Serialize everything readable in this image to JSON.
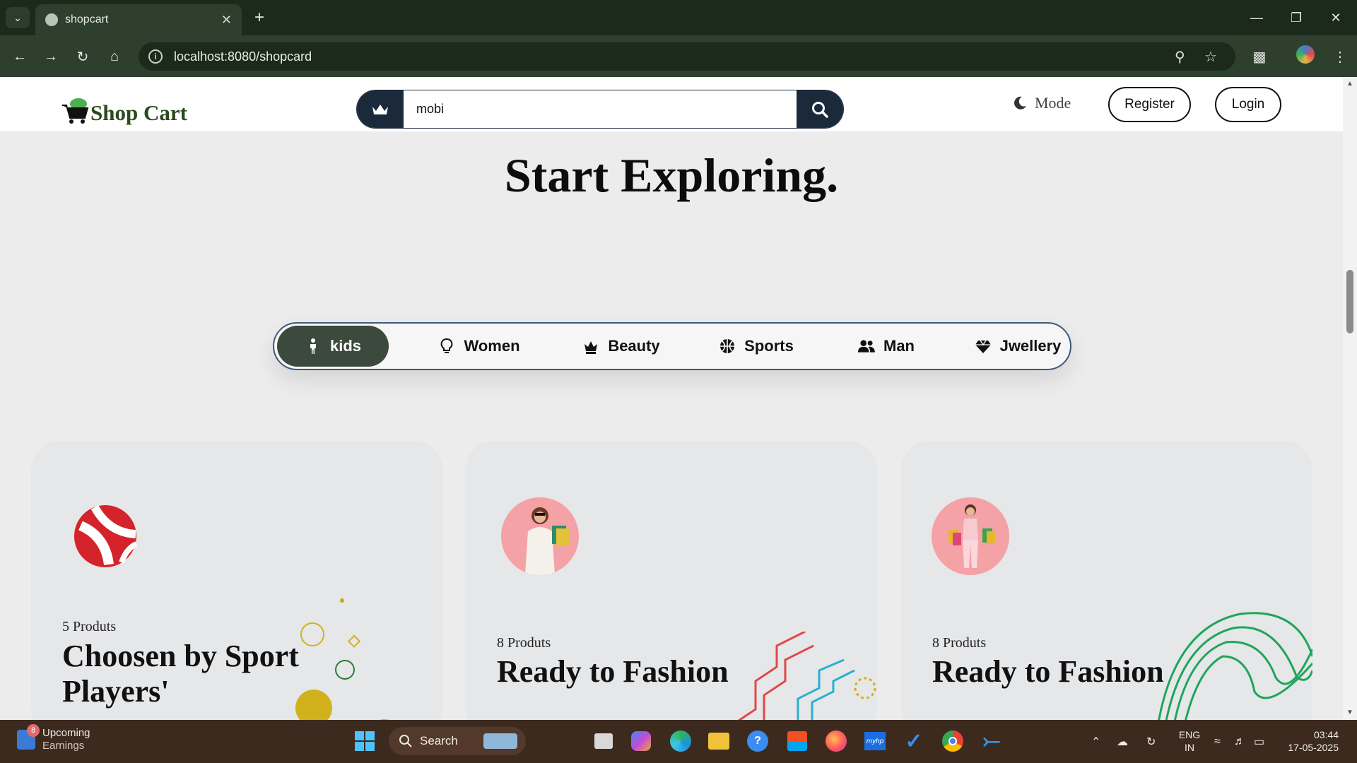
{
  "browser": {
    "tab_title": "shopcart",
    "url": "localhost:8080/shopcard"
  },
  "site": {
    "brand": "Shop Cart",
    "search_value": "mobi",
    "mode_label": "Mode",
    "register_label": "Register",
    "login_label": "Login"
  },
  "hero": {
    "title": "Start Exploring."
  },
  "categories": [
    {
      "label": "kids",
      "icon": "child-icon",
      "active": true
    },
    {
      "label": "Women",
      "icon": "lightbulb-icon",
      "active": false
    },
    {
      "label": "Beauty",
      "icon": "crown-icon",
      "active": false
    },
    {
      "label": "Sports",
      "icon": "basketball-icon",
      "active": false
    },
    {
      "label": "Man",
      "icon": "users-icon",
      "active": false
    },
    {
      "label": "Jwellery",
      "icon": "gem-icon",
      "active": false
    }
  ],
  "cards": [
    {
      "count": "5 Produts",
      "title": "Choosen by Sport Players'",
      "image": "volleyball"
    },
    {
      "count": "8 Produts",
      "title": "Ready to Fashion",
      "image": "woman-shopping"
    },
    {
      "count": "8 Produts",
      "title": "Ready to Fashion",
      "image": "woman-shopping-pink"
    }
  ],
  "taskbar": {
    "weather_title": "Upcoming",
    "weather_sub": "Earnings",
    "weather_badge": "8",
    "search_label": "Search",
    "lang_top": "ENG",
    "lang_bottom": "IN",
    "time": "03:44",
    "date": "17-05-2025"
  },
  "colors": {
    "browser_frame": "#1b2a1b",
    "toolbar": "#2e3f2e",
    "brand_green": "#2a4a1e",
    "search_navy": "#1a2a3a",
    "active_category": "#3c4a3e",
    "card_bg": "#e6e7e9",
    "page_bg": "#ececec",
    "taskbar": "#3d2a1f"
  }
}
